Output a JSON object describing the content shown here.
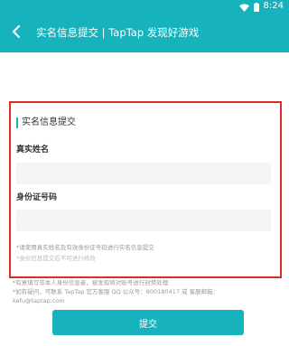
{
  "status_bar": {
    "time": "8:24",
    "icons": [
      "wifi-icon",
      "battery-icon"
    ]
  },
  "header": {
    "back_icon": "chevron-left-icon",
    "title": "实名信息提交 | TapTap 发现好游戏"
  },
  "form": {
    "section_title": "实名信息提交",
    "name_label": "真实姓名",
    "name_value": "",
    "id_label": "身份证号码",
    "id_value": "",
    "notices": [
      "*请使用真实姓名及有效身份证号码进行实名信息提交",
      "*身份信息提交后不可进行修改"
    ]
  },
  "extra_notices": [
    "*有意填写非本人身份信息者，被发现将对账号进行封禁处理",
    "*如有疑问，可联系 TapTap 官方客服 QQ 公众号：800180417 或 客服邮箱：",
    "kefu@taptap.com"
  ],
  "submit_label": "提交",
  "colors": {
    "brand": "#17b3bd",
    "highlight_border": "#e02a2a"
  }
}
